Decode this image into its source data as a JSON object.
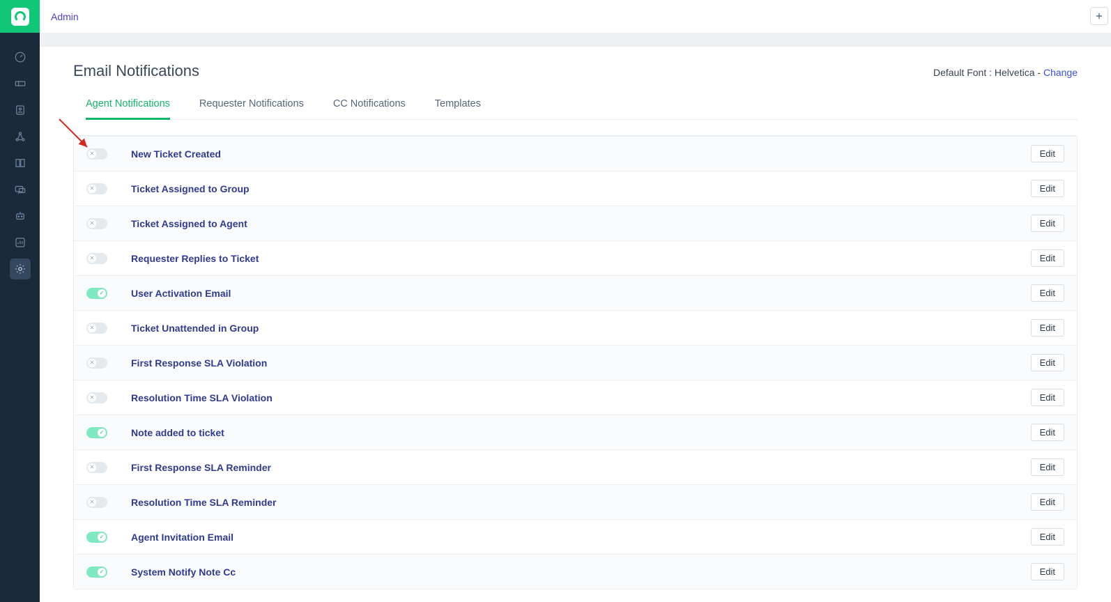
{
  "breadcrumb": "Admin",
  "page": {
    "title": "Email Notifications",
    "default_font_label": "Default Font : ",
    "default_font_value": "Helvetica",
    "separator": " - ",
    "change_link": "Change"
  },
  "tabs": [
    {
      "label": "Agent Notifications",
      "active": true
    },
    {
      "label": "Requester Notifications",
      "active": false
    },
    {
      "label": "CC Notifications",
      "active": false
    },
    {
      "label": "Templates",
      "active": false
    }
  ],
  "edit_label": "Edit",
  "rows": [
    {
      "label": "New Ticket Created",
      "on": false
    },
    {
      "label": "Ticket Assigned to Group",
      "on": false
    },
    {
      "label": "Ticket Assigned to Agent",
      "on": false
    },
    {
      "label": "Requester Replies to Ticket",
      "on": false
    },
    {
      "label": "User Activation Email",
      "on": true
    },
    {
      "label": "Ticket Unattended in Group",
      "on": false
    },
    {
      "label": "First Response SLA Violation",
      "on": false
    },
    {
      "label": "Resolution Time SLA Violation",
      "on": false
    },
    {
      "label": "Note added to ticket",
      "on": true
    },
    {
      "label": "First Response SLA Reminder",
      "on": false
    },
    {
      "label": "Resolution Time SLA Reminder",
      "on": false
    },
    {
      "label": "Agent Invitation Email",
      "on": true
    },
    {
      "label": "System Notify Note Cc",
      "on": true
    }
  ],
  "sidebar_items": [
    "dashboard",
    "tickets",
    "contacts",
    "social",
    "solutions",
    "forums",
    "bots",
    "reports",
    "admin"
  ]
}
